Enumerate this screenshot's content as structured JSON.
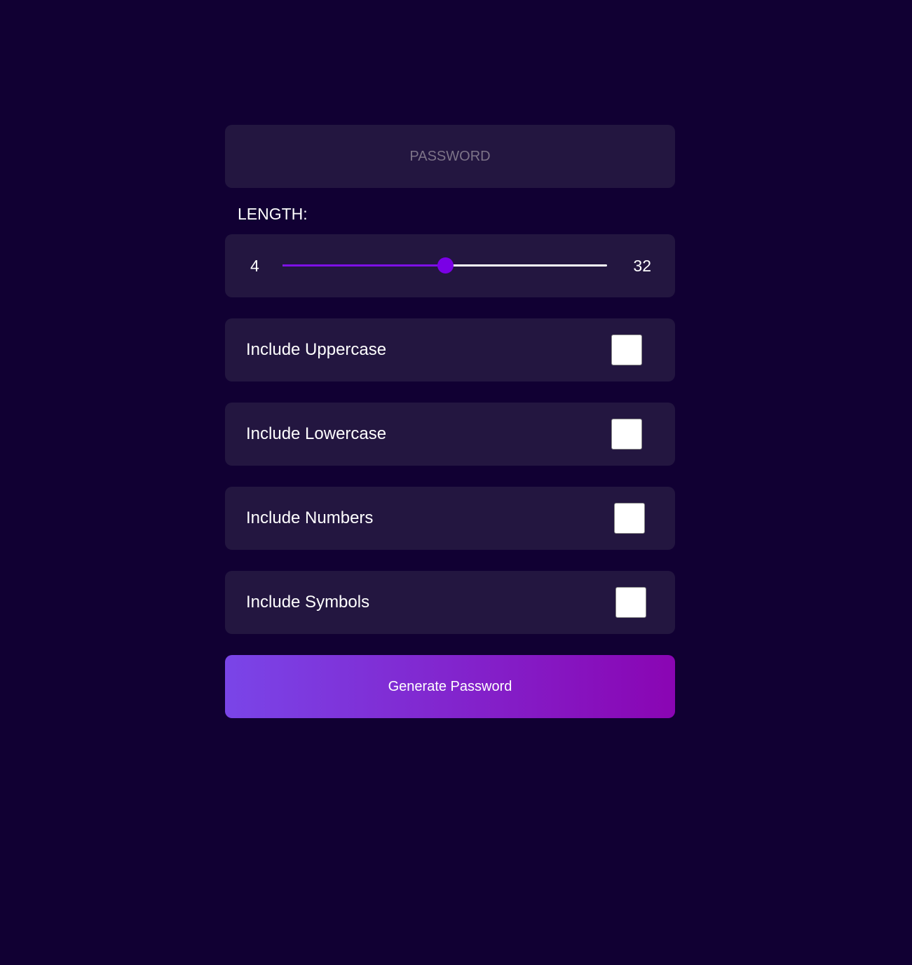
{
  "password": {
    "placeholder": "PASSWORD",
    "value": ""
  },
  "length": {
    "label": "LENGTH:",
    "min": "4",
    "max": "32",
    "current": 18
  },
  "options": [
    {
      "label": "Include Uppercase",
      "checked": false
    },
    {
      "label": "Include Lowercase",
      "checked": false
    },
    {
      "label": "Include Numbers",
      "checked": false
    },
    {
      "label": "Include Symbols",
      "checked": false
    }
  ],
  "generate_button": {
    "label": "Generate Password"
  },
  "colors": {
    "background": "#110033",
    "panel": "#231640",
    "accent": "#7a00e6",
    "button_gradient_start": "#7a45e8",
    "button_gradient_end": "#8a05b3"
  }
}
